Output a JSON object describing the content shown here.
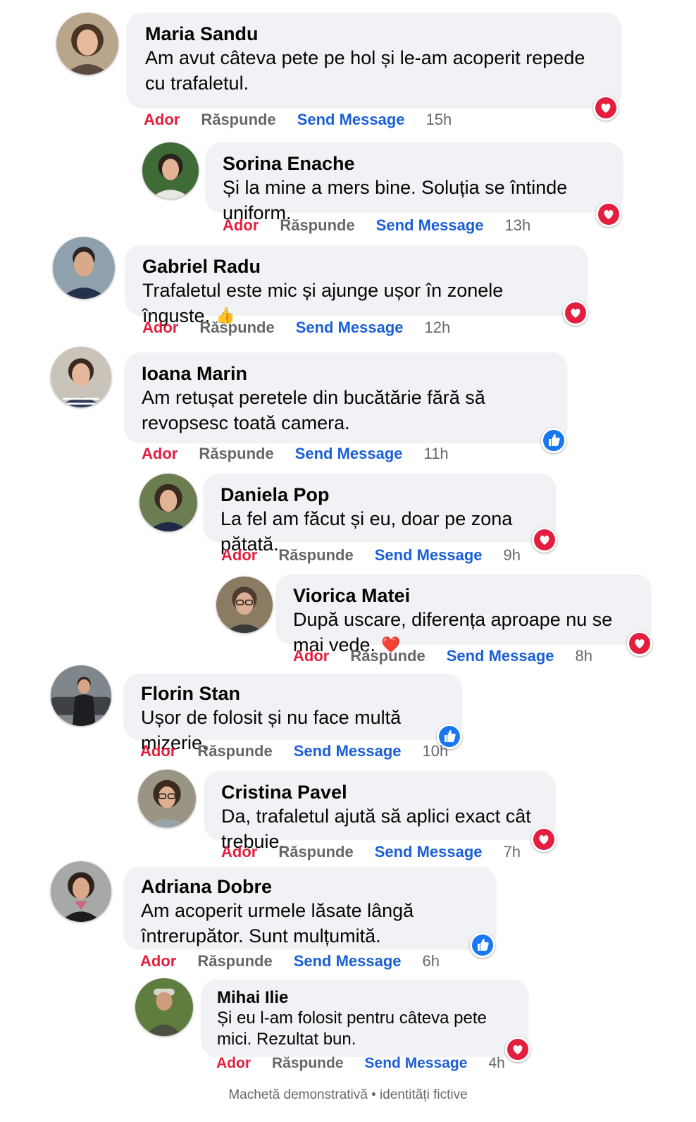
{
  "colors": {
    "love": "#e41e3f",
    "link": "#1b5fd6",
    "muted": "#65676b",
    "bubble": "#f0f2f5",
    "like": "#1877f2"
  },
  "comments": [
    {
      "name": "Maria Sandu",
      "text": "Am avut câteva pete pe hol și le-am acoperit repede cu trafaletul.",
      "tail": "",
      "reaction": "love",
      "love": "Ador",
      "reply": "Răspunde",
      "message": "Send Message",
      "time": "15h",
      "avatar": "woman-portrait"
    },
    {
      "name": "Sorina Enache",
      "text": "Și la mine a mers bine. Soluția se întinde uniform.",
      "tail": "",
      "reaction": "love",
      "love": "Ador",
      "reply": "Răspunde",
      "message": "Send Message",
      "time": "13h",
      "avatar": "woman-portrait"
    },
    {
      "name": "Gabriel Radu",
      "text": "Trafaletul este mic și ajunge ușor în zonele înguste.",
      "tail": "👍",
      "reaction": "love",
      "love": "Ador",
      "reply": "Răspunde",
      "message": "Send Message",
      "time": "12h",
      "avatar": "man-portrait"
    },
    {
      "name": "Ioana Marin",
      "text": "Am retușat peretele din bucătărie fără să revopsesc toată camera.",
      "tail": "",
      "reaction": "like",
      "love": "Ador",
      "reply": "Răspunde",
      "message": "Send Message",
      "time": "11h",
      "avatar": "woman-portrait"
    },
    {
      "name": "Daniela Pop",
      "text": "La fel am făcut și eu, doar pe zona pătată.",
      "tail": "",
      "reaction": "love",
      "love": "Ador",
      "reply": "Răspunde",
      "message": "Send Message",
      "time": "9h",
      "avatar": "woman-portrait"
    },
    {
      "name": "Viorica Matei",
      "text": "După uscare, diferența aproape nu se mai vede.",
      "tail": "❤️",
      "reaction": "love",
      "love": "Ador",
      "reply": "Răspunde",
      "message": "Send Message",
      "time": "8h",
      "avatar": "woman-portrait"
    },
    {
      "name": "Florin Stan",
      "text": "Ușor de folosit și nu face multă mizerie.",
      "tail": "",
      "reaction": "like",
      "love": "Ador",
      "reply": "Răspunde",
      "message": "Send Message",
      "time": "10h",
      "avatar": "man-portrait"
    },
    {
      "name": "Cristina Pavel",
      "text": "Da, trafaletul ajută să aplici exact cât trebuie.",
      "tail": "",
      "reaction": "love",
      "love": "Ador",
      "reply": "Răspunde",
      "message": "Send Message",
      "time": "7h",
      "avatar": "woman-portrait"
    },
    {
      "name": "Adriana Dobre",
      "text": "Am acoperit urmele lăsate lângă întrerupător. Sunt mulțumită.",
      "tail": "",
      "reaction": "like",
      "love": "Ador",
      "reply": "Răspunde",
      "message": "Send Message",
      "time": "6h",
      "avatar": "woman-portrait"
    },
    {
      "name": "Mihai Ilie",
      "text": "Și eu l-am folosit pentru câteva pete mici. Rezultat bun.",
      "tail": "",
      "reaction": "love",
      "love": "Ador",
      "reply": "Răspunde",
      "message": "Send Message",
      "time": "4h",
      "avatar": "man-portrait"
    }
  ],
  "footer": "Machetă demonstrativă • identități fictive"
}
